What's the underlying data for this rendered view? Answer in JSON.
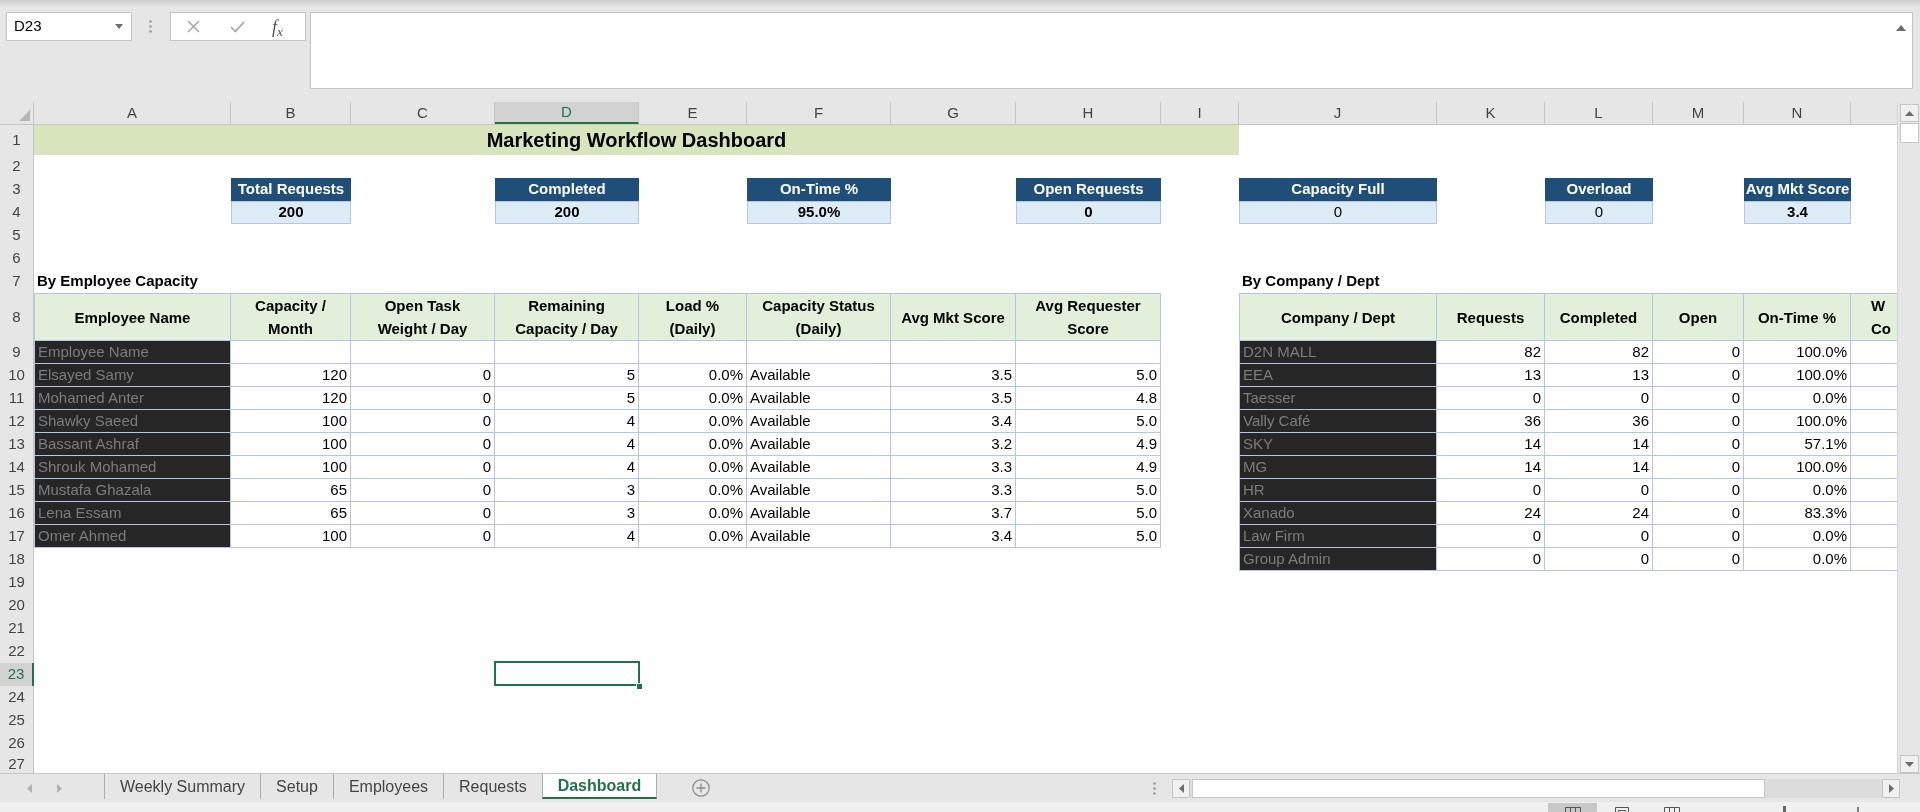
{
  "name_box": {
    "value": "D23"
  },
  "formula_bar": {
    "function_label": "f$_{x}$"
  },
  "column_headers": [
    {
      "label": "A",
      "selected": false
    },
    {
      "label": "B",
      "selected": false
    },
    {
      "label": "C",
      "selected": false
    },
    {
      "label": "D",
      "selected": true
    },
    {
      "label": "E",
      "selected": false
    },
    {
      "label": "F",
      "selected": false
    },
    {
      "label": "G",
      "selected": false
    },
    {
      "label": "H",
      "selected": false
    },
    {
      "label": "I",
      "selected": false
    },
    {
      "label": "J",
      "selected": false
    },
    {
      "label": "K",
      "selected": false
    },
    {
      "label": "L",
      "selected": false
    },
    {
      "label": "M",
      "selected": false
    },
    {
      "label": "N",
      "selected": false
    }
  ],
  "row_headers": [
    {
      "label": "1",
      "selected": false
    },
    {
      "label": "2",
      "selected": false
    },
    {
      "label": "3",
      "selected": false
    },
    {
      "label": "4",
      "selected": false
    },
    {
      "label": "5",
      "selected": false
    },
    {
      "label": "6",
      "selected": false
    },
    {
      "label": "7",
      "selected": false
    },
    {
      "label": "8",
      "selected": false
    },
    {
      "label": "9",
      "selected": false
    },
    {
      "label": "10",
      "selected": false
    },
    {
      "label": "11",
      "selected": false
    },
    {
      "label": "12",
      "selected": false
    },
    {
      "label": "13",
      "selected": false
    },
    {
      "label": "14",
      "selected": false
    },
    {
      "label": "15",
      "selected": false
    },
    {
      "label": "16",
      "selected": false
    },
    {
      "label": "17",
      "selected": false
    },
    {
      "label": "18",
      "selected": false
    },
    {
      "label": "19",
      "selected": false
    },
    {
      "label": "20",
      "selected": false
    },
    {
      "label": "21",
      "selected": false
    },
    {
      "label": "22",
      "selected": false
    },
    {
      "label": "23",
      "selected": true
    },
    {
      "label": "24",
      "selected": false
    },
    {
      "label": "25",
      "selected": false
    },
    {
      "label": "26",
      "selected": false
    },
    {
      "label": "27",
      "selected": false
    }
  ],
  "title": "Marketing Workflow Dashboard",
  "kpis": [
    {
      "label": "Total Requests",
      "value": "200",
      "emphasized": true
    },
    {
      "label": "Completed",
      "value": "200",
      "emphasized": true
    },
    {
      "label": "On-Time %",
      "value": "95.0%",
      "emphasized": true
    },
    {
      "label": "Open Requests",
      "value": "0",
      "emphasized": true
    },
    {
      "label": "Capacity Full",
      "value": "0",
      "emphasized": false
    },
    {
      "label": "Overload",
      "value": "0",
      "emphasized": false
    },
    {
      "label": "Avg Mkt Score",
      "value": "3.4",
      "emphasized": true
    }
  ],
  "employee_table": {
    "caption": "By Employee Capacity",
    "columns": [
      "Employee Name",
      "Capacity /\nMonth",
      "Open Task\nWeight / Day",
      "Remaining\nCapacity / Day",
      "Load %\n(Daily)",
      "Capacity Status\n(Daily)",
      "Avg Mkt Score",
      "Avg Requester\nScore"
    ],
    "rows": [
      [
        "Employee Name"
      ],
      [
        "Elsayed Samy",
        "120",
        "0",
        "5",
        "0.0%",
        "Available",
        "3.5",
        "5.0"
      ],
      [
        "Mohamed Anter",
        "120",
        "0",
        "5",
        "0.0%",
        "Available",
        "3.5",
        "4.8"
      ],
      [
        "Shawky Saeed",
        "100",
        "0",
        "4",
        "0.0%",
        "Available",
        "3.4",
        "5.0"
      ],
      [
        "Bassant Ashraf",
        "100",
        "0",
        "4",
        "0.0%",
        "Available",
        "3.2",
        "4.9"
      ],
      [
        "Shrouk Mohamed",
        "100",
        "0",
        "4",
        "0.0%",
        "Available",
        "3.3",
        "4.9"
      ],
      [
        "Mustafa Ghazala",
        "65",
        "0",
        "3",
        "0.0%",
        "Available",
        "3.3",
        "5.0"
      ],
      [
        "Lena Essam",
        "65",
        "0",
        "3",
        "0.0%",
        "Available",
        "3.7",
        "5.0"
      ],
      [
        "Omer Ahmed",
        "100",
        "0",
        "4",
        "0.0%",
        "Available",
        "3.4",
        "5.0"
      ]
    ]
  },
  "company_table": {
    "caption": "By Company / Dept",
    "columns": [
      "Company / Dept",
      "Requests",
      "Completed",
      "Open",
      "On-Time %",
      "W\nCo"
    ],
    "rows": [
      [
        "D2N MALL",
        "82",
        "82",
        "0",
        "100.0%"
      ],
      [
        "EEA",
        "13",
        "13",
        "0",
        "100.0%"
      ],
      [
        "Taesser",
        "0",
        "0",
        "0",
        "0.0%"
      ],
      [
        "Vally Café",
        "36",
        "36",
        "0",
        "100.0%"
      ],
      [
        "SKY",
        "14",
        "14",
        "0",
        "57.1%"
      ],
      [
        "MG",
        "14",
        "14",
        "0",
        "100.0%"
      ],
      [
        "HR",
        "0",
        "0",
        "0",
        "0.0%"
      ],
      [
        "Xanado",
        "24",
        "24",
        "0",
        "83.3%"
      ],
      [
        "Law Firm",
        "0",
        "0",
        "0",
        "0.0%"
      ],
      [
        "Group Admin",
        "0",
        "0",
        "0",
        "0.0%"
      ]
    ]
  },
  "sheet_tabs": [
    {
      "label": "Weekly Summary",
      "selected": false
    },
    {
      "label": "Setup",
      "selected": false
    },
    {
      "label": "Employees",
      "selected": false
    },
    {
      "label": "Requests",
      "selected": false
    },
    {
      "label": "Dashboard",
      "selected": true
    }
  ]
}
